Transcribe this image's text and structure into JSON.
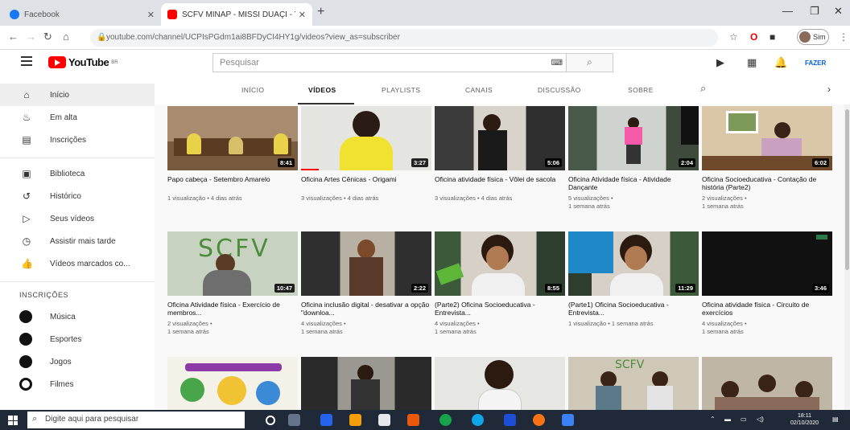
{
  "browser": {
    "tabs": [
      {
        "title": "Facebook",
        "color": "#1877f2"
      },
      {
        "title": "SCFV MINAP - MISSI DUAÇI - Yo",
        "color": "#ff0000"
      }
    ],
    "url": "youtube.com/channel/UCPIsPGdm1ai8BFDyCI4HY1g/videos?view_as=subscriber",
    "profile_label": "Sim"
  },
  "header": {
    "logo_text": "YouTube",
    "logo_suffix": "BR",
    "search_placeholder": "Pesquisar",
    "search_keyboard": "⌨",
    "signin": "FAZER"
  },
  "sidebar": {
    "primary": [
      {
        "label": "Início",
        "icon": "home-icon"
      },
      {
        "label": "Em alta",
        "icon": "trending-icon"
      },
      {
        "label": "Inscrições",
        "icon": "subscriptions-icon"
      }
    ],
    "library": [
      {
        "label": "Biblioteca",
        "icon": "library-icon"
      },
      {
        "label": "Histórico",
        "icon": "history-icon"
      },
      {
        "label": "Seus vídeos",
        "icon": "your-videos-icon"
      },
      {
        "label": "Assistir mais tarde",
        "icon": "watch-later-icon"
      },
      {
        "label": "Vídeos marcados co...",
        "icon": "liked-icon"
      }
    ],
    "subscriptions_heading": "INSCRIÇÕES",
    "subscriptions": [
      {
        "label": "Música"
      },
      {
        "label": "Esportes"
      },
      {
        "label": "Jogos"
      },
      {
        "label": "Filmes"
      }
    ]
  },
  "channel_tabs": [
    "INÍCIO",
    "VÍDEOS",
    "PLAYLISTS",
    "CANAIS",
    "DISCUSSÃO",
    "SOBRE"
  ],
  "videos": [
    {
      "title": "Papo cabeça - Setembro Amarelo",
      "meta": "1 visualização • 4 dias atrás",
      "duration": "8:41"
    },
    {
      "title": "Oficina Artes Cênicas - Origami",
      "meta": "3 visualizações • 4 dias atrás",
      "duration": "3:27"
    },
    {
      "title": "Oficina atividade física - Vôlei de sacola",
      "meta": "3 visualizações • 4 dias atrás",
      "duration": "5:06"
    },
    {
      "title": "Oficina Atividade física - Atividade Dançante",
      "meta": "5 visualizações •\n1 semana atrás",
      "duration": "2:04"
    },
    {
      "title": "Oficina Socioeducativa - Contação de história (Parte2)",
      "meta": "2 visualizações •\n1 semana atrás",
      "duration": "6:02"
    },
    {
      "title": "Oficina Atividade física - Exercício de membros...",
      "meta": "2 visualizações •\n1 semana atrás",
      "duration": "10:47"
    },
    {
      "title": "Oficina inclusão digital - desativar a opção \"downloa...",
      "meta": "4 visualizações •\n1 semana atrás",
      "duration": "2:22"
    },
    {
      "title": "(Parte2) Oficina Socioeducativa - Entrevista...",
      "meta": "4 visualizações •\n1 semana atrás",
      "duration": "8:55"
    },
    {
      "title": "(Parte1) Oficina Socioeducativa - Entrevista...",
      "meta": "1 visualização • 1 semana atrás",
      "duration": "11:29"
    },
    {
      "title": "Oficina atividade física - Circuito de exercícios",
      "meta": "4 visualizações •\n1 semana atrás",
      "duration": "3:46"
    }
  ],
  "taskbar": {
    "search_placeholder": "Digite aqui para pesquisar",
    "time": "18:11",
    "date": "02/10/2020"
  }
}
